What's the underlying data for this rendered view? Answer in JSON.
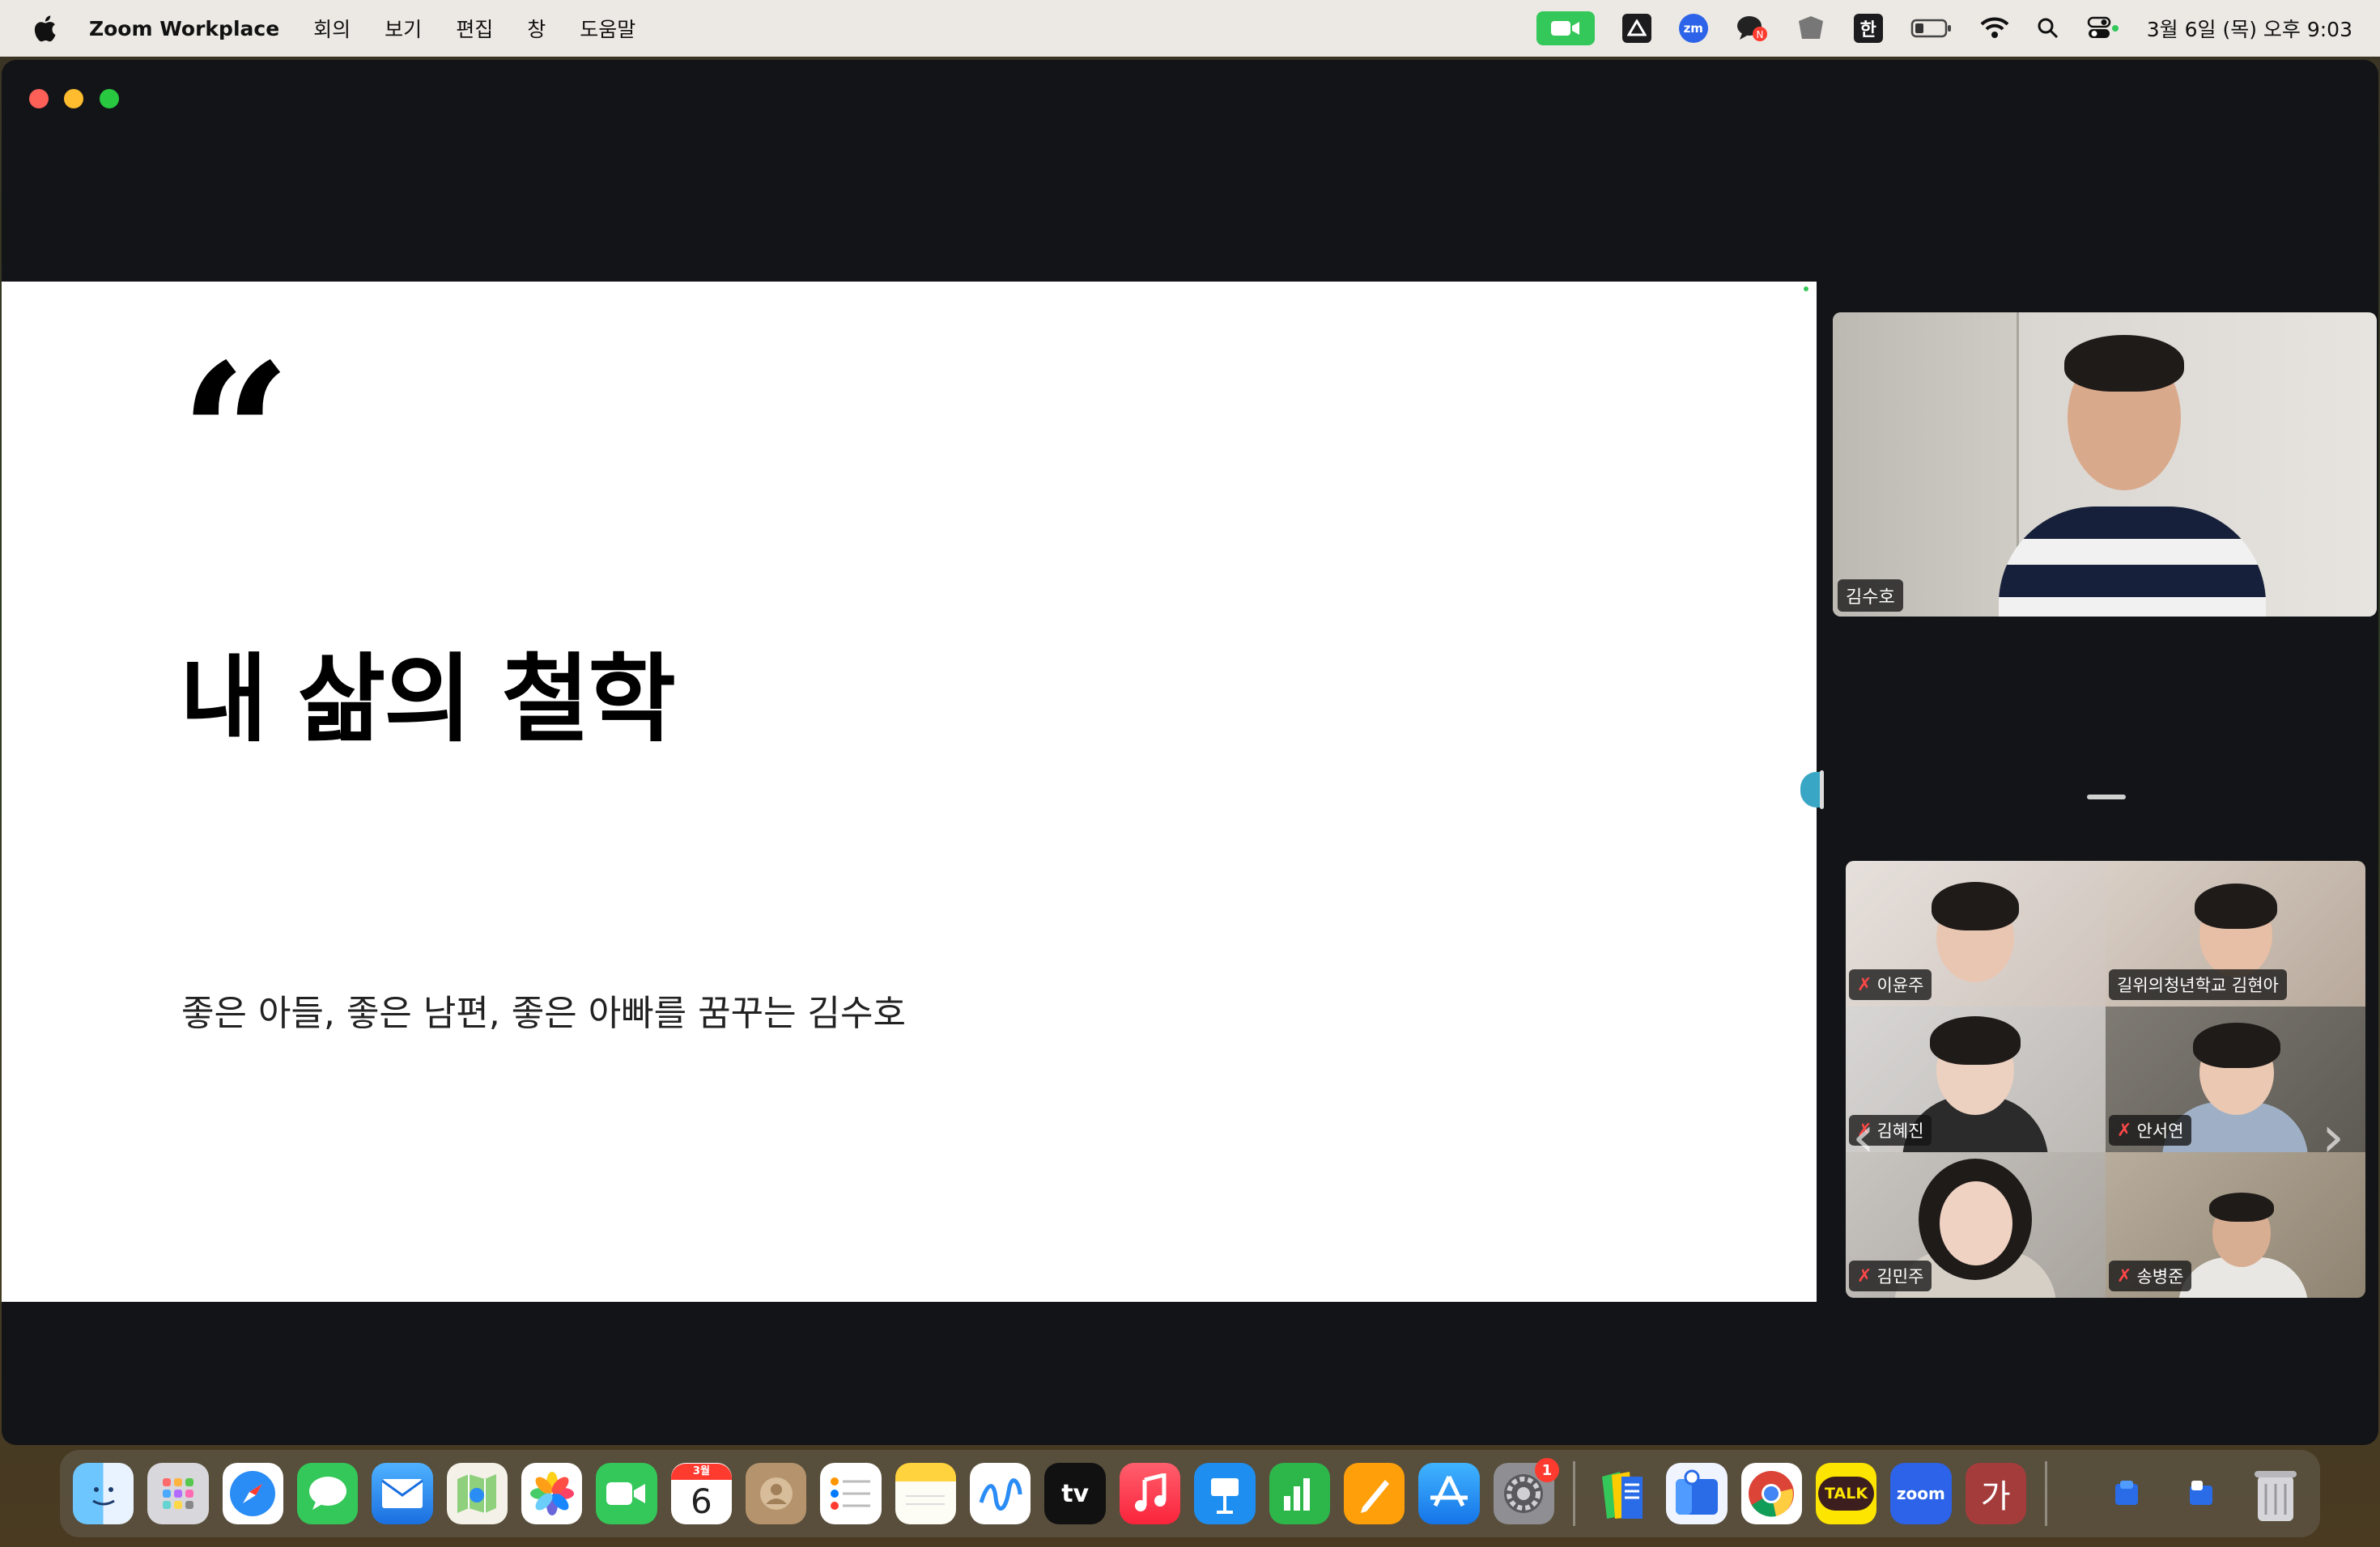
{
  "menubar": {
    "app_name": "Zoom Workplace",
    "menus": [
      "회의",
      "보기",
      "편집",
      "창",
      "도움말"
    ],
    "ime_label": "한",
    "clock": "3월 6일 (목) 오후 9:03"
  },
  "slide": {
    "quote_mark": "“",
    "title": "내 삶의 철학",
    "subtitle": "좋은 아들, 좋은 남편, 좋은 아빠를 꿈꾸는 김수호"
  },
  "speaker": {
    "name": "김수호"
  },
  "participants": [
    {
      "name": "이윤주",
      "muted": true
    },
    {
      "name": "길위의청년학교 김현아",
      "muted": false
    },
    {
      "name": "김혜진",
      "muted": true
    },
    {
      "name": "안서연",
      "muted": true
    },
    {
      "name": "김민주",
      "muted": true
    },
    {
      "name": "송병준",
      "muted": true
    }
  ],
  "dock": {
    "calendar_month": "3월",
    "calendar_day": "6",
    "tv_label": "tv",
    "talk_label": "TALK",
    "zoom_label": "zoom",
    "ga_label": "가",
    "settings_badge": "1"
  }
}
